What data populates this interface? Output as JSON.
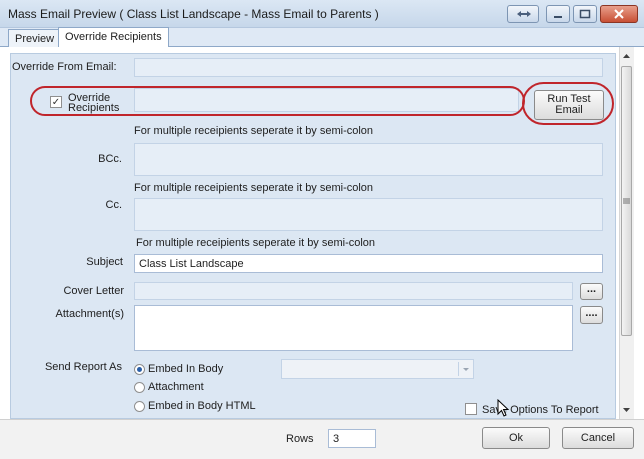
{
  "window": {
    "title": "Mass Email Preview ( Class List Landscape - Mass Email to Parents )"
  },
  "tabs": [
    {
      "label": "Preview",
      "active": false
    },
    {
      "label": "Override Recipients",
      "active": true
    }
  ],
  "form": {
    "override_from_label": "Override From Email:",
    "override_from_value": "",
    "override_recipients_label": "Override Recipients",
    "override_recipients_checked": true,
    "override_recipients_value": "",
    "run_test_email_label": "Run Test Email",
    "hint_1": "For multiple receipients seperate it by semi-colon",
    "bcc_label": "BCc.",
    "bcc_value": "",
    "hint_2": "For multiple receipients seperate it by semi-colon",
    "cc_label": "Cc.",
    "cc_value": "",
    "hint_3": "For multiple receipients seperate it by semi-colon",
    "subject_label": "Subject",
    "subject_value": "Class List Landscape",
    "cover_letter_label": "Cover Letter",
    "cover_letter_value": "",
    "attachments_label": "Attachment(s)",
    "browse_label": "...",
    "browse2_label": "....",
    "send_report_as_label": "Send Report As",
    "send_options": [
      {
        "label": "Embed In Body",
        "selected": true
      },
      {
        "label": "Attachment",
        "selected": false
      },
      {
        "label": "Embed in Body HTML",
        "selected": false
      }
    ],
    "format_select_value": "",
    "save_options_label": "Save Options To Report",
    "save_options_checked": false
  },
  "footer": {
    "rows_label": "Rows",
    "rows_value": "3",
    "ok_label": "Ok",
    "cancel_label": "Cancel"
  },
  "colors": {
    "highlight_oval": "#c0252b",
    "form_background": "#dce7f3",
    "titlebar": "#c6d7ea"
  }
}
